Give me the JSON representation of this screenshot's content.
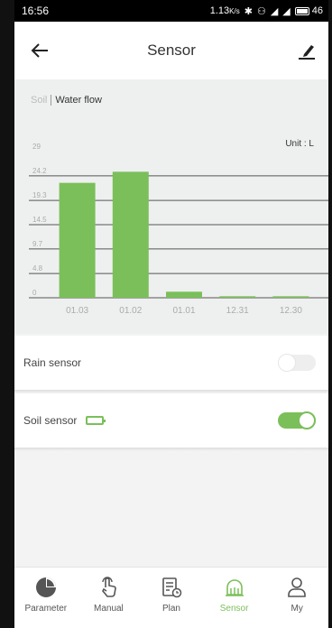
{
  "statusbar": {
    "time": "16:56",
    "speed": "1.13",
    "speed_unit": "K/s",
    "battery": "46"
  },
  "appbar": {
    "title": "Sensor"
  },
  "segment": {
    "options": [
      "Soil",
      "Water flow"
    ],
    "selected": "Water flow"
  },
  "chart_unit": "Unit : L",
  "chart_data": {
    "type": "bar",
    "categories": [
      "01.03",
      "01.02",
      "01.01",
      "12.31",
      "12.30"
    ],
    "values": [
      22.8,
      25.0,
      1.2,
      0.3,
      0.3
    ],
    "yticks": [
      "0",
      "4.8",
      "9.7",
      "14.5",
      "19.3",
      "24.2",
      "29"
    ],
    "ytick_values": [
      0,
      4.8,
      9.7,
      14.5,
      19.3,
      24.2,
      29
    ],
    "ylim": [
      0,
      29
    ],
    "grid": true,
    "bar_color": "#7bbf5a"
  },
  "sensors": [
    {
      "label": "Rain sensor",
      "enabled": false
    },
    {
      "label": "Soil sensor",
      "enabled": true
    }
  ],
  "tabs": [
    {
      "label": "Parameter",
      "icon": "pie-chart-icon",
      "active": false
    },
    {
      "label": "Manual",
      "icon": "hand-touch-icon",
      "active": false
    },
    {
      "label": "Plan",
      "icon": "plan-clock-icon",
      "active": false
    },
    {
      "label": "Sensor",
      "icon": "sensor-icon",
      "active": true
    },
    {
      "label": "My",
      "icon": "user-icon",
      "active": false
    }
  ],
  "colors": {
    "accent": "#7bbf5a",
    "background": "#f3f3f3"
  }
}
